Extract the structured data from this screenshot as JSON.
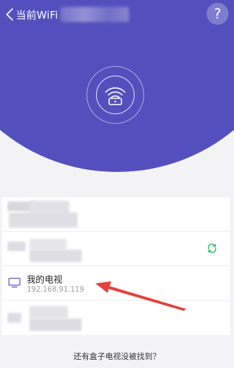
{
  "header": {
    "title": "当前WiFi",
    "back_icon": "chevron-left-icon",
    "help_label": "?",
    "background": "#5350bd"
  },
  "router": {
    "icon": "router-wifi-icon"
  },
  "devices": [
    {
      "name": "",
      "ip": "",
      "icon": "blurred"
    },
    {
      "name": "",
      "ip": "",
      "icon": "sync-icon"
    },
    {
      "name": "我的电视",
      "ip": "192.168.91.119",
      "icon": "tv-icon"
    },
    {
      "name": "",
      "ip": "",
      "icon": "blurred"
    }
  ],
  "footer": {
    "link_label": "还有盒子电视没被找到？"
  },
  "colors": {
    "accent": "#5350bd",
    "sync_green": "#2fb36b",
    "tv_icon": "#5a57c8",
    "arrow_red": "#e5413a"
  }
}
